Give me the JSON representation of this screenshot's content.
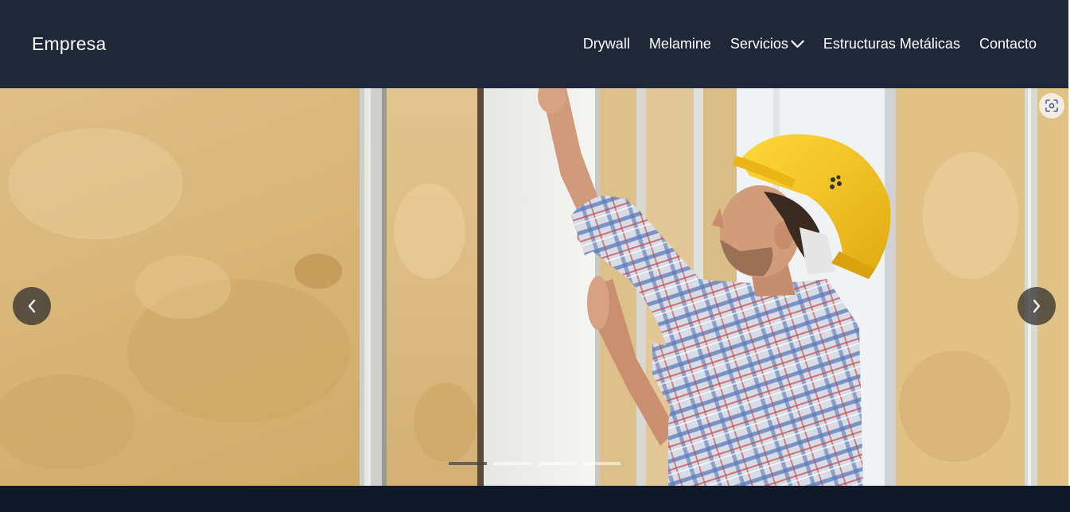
{
  "navbar": {
    "brand": "Empresa",
    "links": [
      {
        "label": "Drywall",
        "dropdown": false
      },
      {
        "label": "Melamine",
        "dropdown": false
      },
      {
        "label": "Servicios",
        "dropdown": true,
        "icon": "chevron-down-icon"
      },
      {
        "label": "Estructuras Metálicas",
        "dropdown": false
      },
      {
        "label": "Contacto",
        "dropdown": false
      }
    ],
    "background": "#1f2738"
  },
  "carousel": {
    "slide_image": "worker-installing-drywall-photo",
    "controls": {
      "prev_icon": "chevron-left-icon",
      "next_icon": "chevron-right-icon",
      "lens_icon": "visual-search-icon"
    },
    "slide_count": 4,
    "active_slide": 1
  },
  "colors": {
    "footer": "#111827",
    "helmet": "#f2c420",
    "insulation": "#d8b77a"
  }
}
